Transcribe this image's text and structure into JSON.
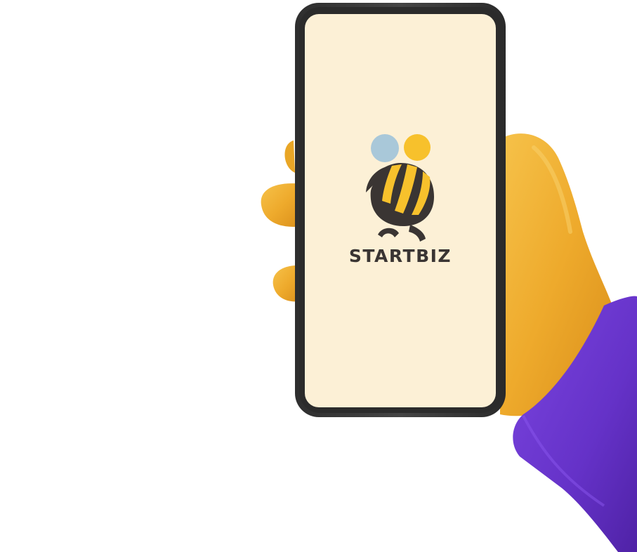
{
  "app": {
    "brand_name": "STARTBIZ",
    "logo_icon": "bee-logo-icon"
  },
  "colors": {
    "screen_background": "#fcf0d6",
    "phone_frame": "#383838",
    "brand_text": "#3a3533",
    "bee_yellow": "#f7c12c",
    "bee_dark": "#3a3533",
    "wing_blue": "#a9c8d9",
    "wing_yellow": "#f7c12c",
    "hand_skin": "#f0b232",
    "sleeve_purple": "#6b33cc"
  }
}
